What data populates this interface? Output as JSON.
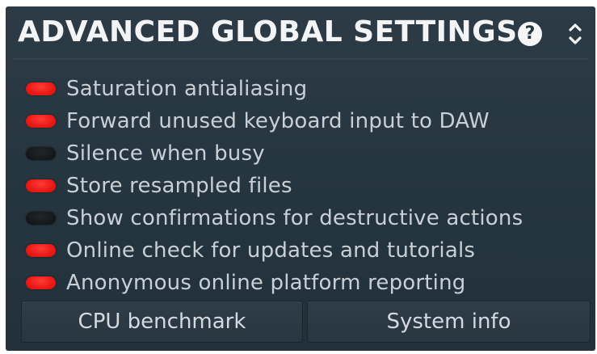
{
  "header": {
    "title": "ADVANCED GLOBAL SETTINGS",
    "help_icon": "question-circle-icon",
    "help_glyph": "?",
    "collapse_icon": "chevron-up-down-icon"
  },
  "options": [
    {
      "label": "Saturation antialiasing",
      "enabled": true
    },
    {
      "label": "Forward unused keyboard input to DAW",
      "enabled": true
    },
    {
      "label": "Silence when busy",
      "enabled": false
    },
    {
      "label": "Store resampled files",
      "enabled": true
    },
    {
      "label": "Show confirmations for destructive actions",
      "enabled": false
    },
    {
      "label": "Online check for updates and tutorials",
      "enabled": true
    },
    {
      "label": "Anonymous online platform reporting",
      "enabled": true
    }
  ],
  "buttons": {
    "cpu_benchmark": "CPU benchmark",
    "system_info": "System info"
  },
  "colors": {
    "panel_background": "#26353f",
    "toggle_on": "#ec1c17",
    "toggle_off": "#151a1d",
    "title_text": "#f2f4f6",
    "label_text": "#c9d0d5"
  }
}
